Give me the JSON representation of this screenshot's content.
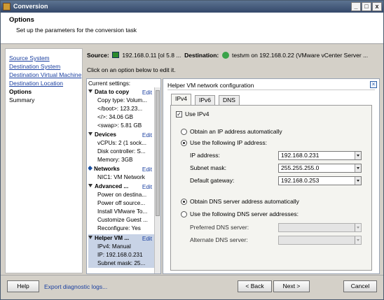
{
  "window": {
    "title": "Conversion",
    "buttons": {
      "minimize": "_",
      "maximize": "□",
      "close": "x"
    }
  },
  "header": {
    "title": "Options",
    "subtitle": "Set up the parameters for the conversion task"
  },
  "nav": {
    "items": [
      {
        "label": "Source System"
      },
      {
        "label": "Destination System"
      },
      {
        "label": "Destination Virtual Machine"
      },
      {
        "label": "Destination Location"
      },
      {
        "label": "Options"
      },
      {
        "label": "Summary"
      }
    ]
  },
  "source_line": {
    "source_label": "Source:",
    "source_value": "192.168.0.11 [ol 5.8 ...",
    "destination_label": "Destination:",
    "destination_value": "testvm on 192.168.0.22 (VMware vCenter Server ..."
  },
  "hint": "Click on an option below to edit it.",
  "settings": {
    "header": "Current settings:",
    "edit_label": "Edit",
    "sections": [
      {
        "title": "Data to copy",
        "values": [
          "Copy type: Volum...",
          "</boot>: 123.23...",
          "</>: 34.06 GB",
          "<swap>: 5.81 GB"
        ]
      },
      {
        "title": "Devices",
        "values": [
          "vCPUs: 2 (1 sock...",
          "Disk controller: S...",
          "Memory: 3GB"
        ]
      },
      {
        "title": "Networks",
        "values": [
          "NIC1: VM Network"
        ]
      },
      {
        "title": "Advanced ...",
        "values": [
          "Power on destina...",
          "Power off source...",
          "Install VMware To...",
          "Customize Guest ...",
          "Reconfigure: Yes"
        ]
      },
      {
        "title": "Helper VM ...",
        "values": [
          "IPv4: Manual",
          "IP: 192.168.0.231",
          "Subnet mask: 25..."
        ]
      }
    ]
  },
  "panel": {
    "title": "Helper VM network configuration",
    "tabs": [
      "IPv4",
      "IPv6",
      "DNS"
    ],
    "use_ipv4": "Use IPv4",
    "obtain_ip_auto": "Obtain an IP address automatically",
    "use_following_ip": "Use the following IP address:",
    "ip_address_label": "IP address:",
    "ip_address_value": "192.168.0.231",
    "subnet_mask_label": "Subnet mask:",
    "subnet_mask_value": "255.255.255.0",
    "default_gateway_label": "Default gateway:",
    "default_gateway_value": "192.168.0.253",
    "obtain_dns_auto": "Obtain DNS server address automatically",
    "use_following_dns": "Use the following DNS server addresses:",
    "preferred_dns_label": "Preferred DNS server:",
    "preferred_dns_value": "",
    "alternate_dns_label": "Alternate DNS server:",
    "alternate_dns_value": ""
  },
  "footer": {
    "help": "Help",
    "export_link": "Export diagnostic logs...",
    "back": "< Back",
    "next": "Next >",
    "cancel": "Cancel"
  }
}
